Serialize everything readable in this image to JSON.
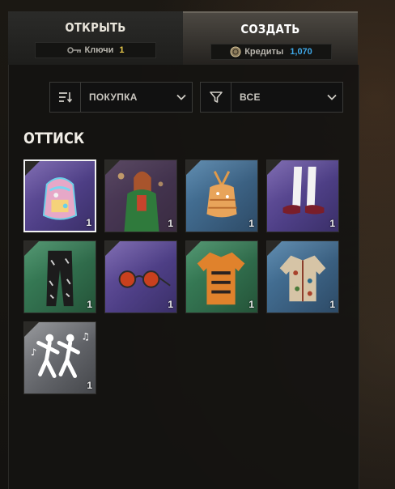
{
  "tabs": {
    "open": {
      "label": "ОТКРЫТЬ",
      "currency_label": "Ключи",
      "currency_value": "1",
      "icon": "key-icon"
    },
    "create": {
      "label": "СОЗДАТЬ",
      "currency_label": "Кредиты",
      "currency_value": "1,070",
      "icon": "credits-coin-icon"
    }
  },
  "filters": {
    "sort": {
      "label": "ПОКУПКА",
      "icon": "sort-icon"
    },
    "filter": {
      "label": "ВСЕ",
      "icon": "funnel-icon"
    }
  },
  "section": {
    "title": "ОТТИСК"
  },
  "items": [
    {
      "qty": "1",
      "rarity": "purple",
      "icon": "backpack-icon",
      "selected": true
    },
    {
      "qty": "1",
      "rarity": "purple",
      "icon": "character-outfit-icon"
    },
    {
      "qty": "1",
      "rarity": "blue",
      "icon": "halter-top-icon"
    },
    {
      "qty": "1",
      "rarity": "purple",
      "icon": "stockings-shoes-icon"
    },
    {
      "qty": "1",
      "rarity": "green",
      "icon": "pants-icon"
    },
    {
      "qty": "1",
      "rarity": "purple",
      "icon": "sunglasses-icon"
    },
    {
      "qty": "1",
      "rarity": "green",
      "icon": "tshirt-icon"
    },
    {
      "qty": "1",
      "rarity": "blue",
      "icon": "shirt-icon"
    },
    {
      "qty": "1",
      "rarity": "gray",
      "icon": "dance-emote-icon"
    }
  ],
  "colors": {
    "key_value": "#e8c94a",
    "credits_value": "#3ea8e8",
    "selected_border": "#f2f2f2"
  }
}
